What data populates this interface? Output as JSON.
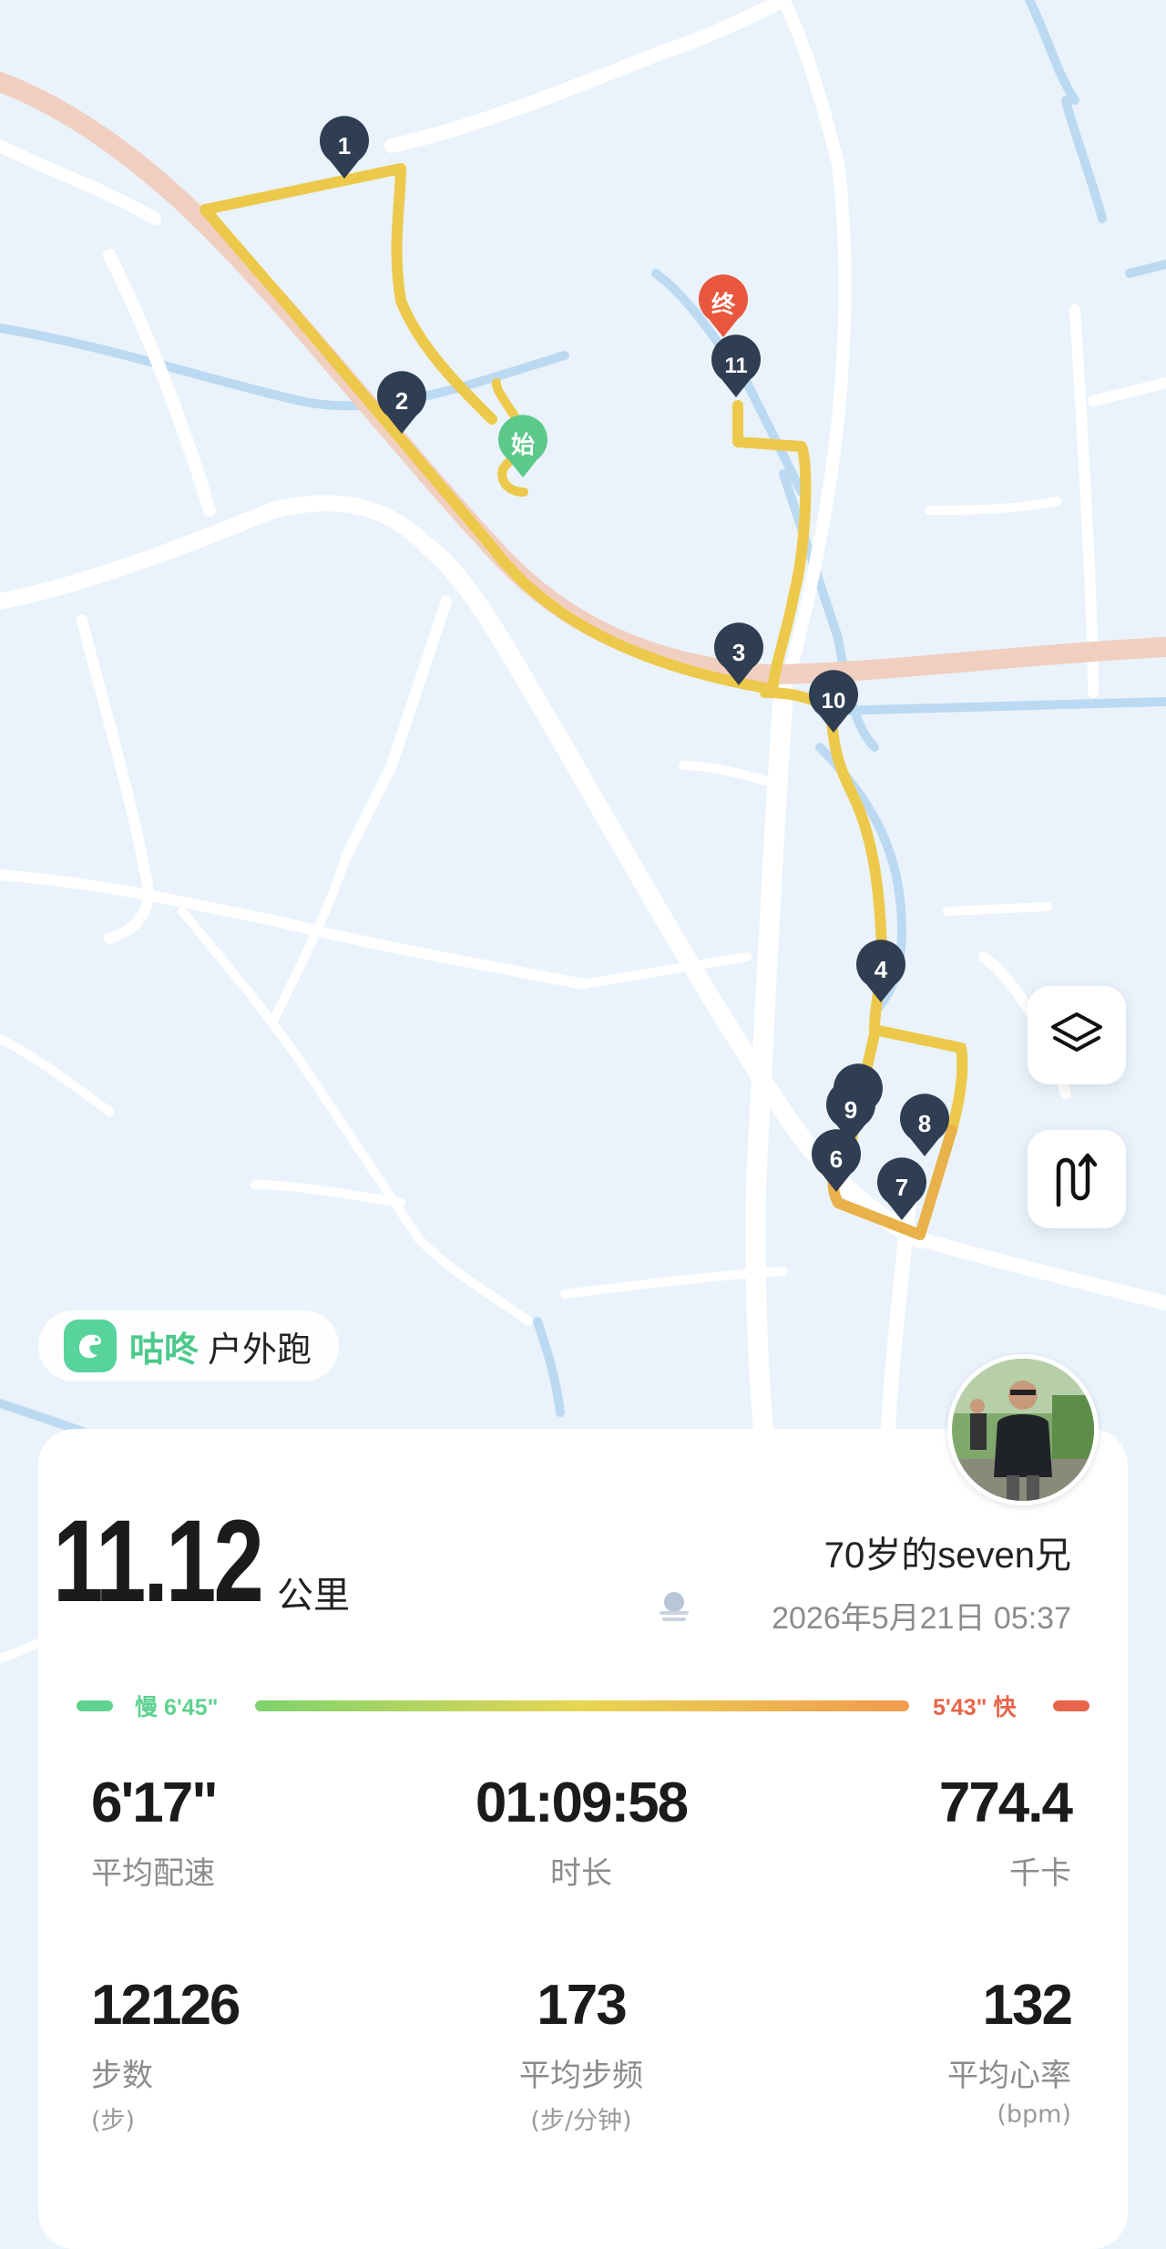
{
  "map": {
    "markers": [
      "1",
      "2",
      "3",
      "4",
      "6",
      "7",
      "8",
      "9",
      "10",
      "11"
    ],
    "start_label": "始",
    "end_label": "终",
    "colors": {
      "route": "#ecc94b",
      "route_dark": "#e8b14a",
      "marker": "#2f3e52",
      "start": "#5cc98a",
      "end": "#e9573f",
      "highway": "#f1cfc0",
      "water": "#bcd9f2"
    }
  },
  "controls": {
    "layers_icon": "layers-icon",
    "route_icon": "route-toggle-icon"
  },
  "brand": {
    "name": "咕咚",
    "mode": "户外跑",
    "logo_icon": "codoon-bird-icon"
  },
  "summary": {
    "distance": "11.12",
    "distance_unit": "公里",
    "user": "70岁的seven兄",
    "datetime": "2026年5月21日 05:37",
    "weather_icon": "cloudy-icon"
  },
  "pace_range": {
    "slow": "慢 6'45\"",
    "fast": "5'43\" 快"
  },
  "stats": {
    "avg_pace": {
      "value": "6'17\"",
      "label": "平均配速"
    },
    "duration": {
      "value": "01:09:58",
      "label": "时长"
    },
    "calories": {
      "value": "774.4",
      "label": "千卡"
    },
    "steps": {
      "value": "12126",
      "label": "步数",
      "unit": "(步)"
    },
    "cadence": {
      "value": "173",
      "label": "平均步频",
      "unit": "(步/分钟)"
    },
    "heart_rate": {
      "value": "132",
      "label": "平均心率",
      "unit": "(bpm)"
    }
  }
}
